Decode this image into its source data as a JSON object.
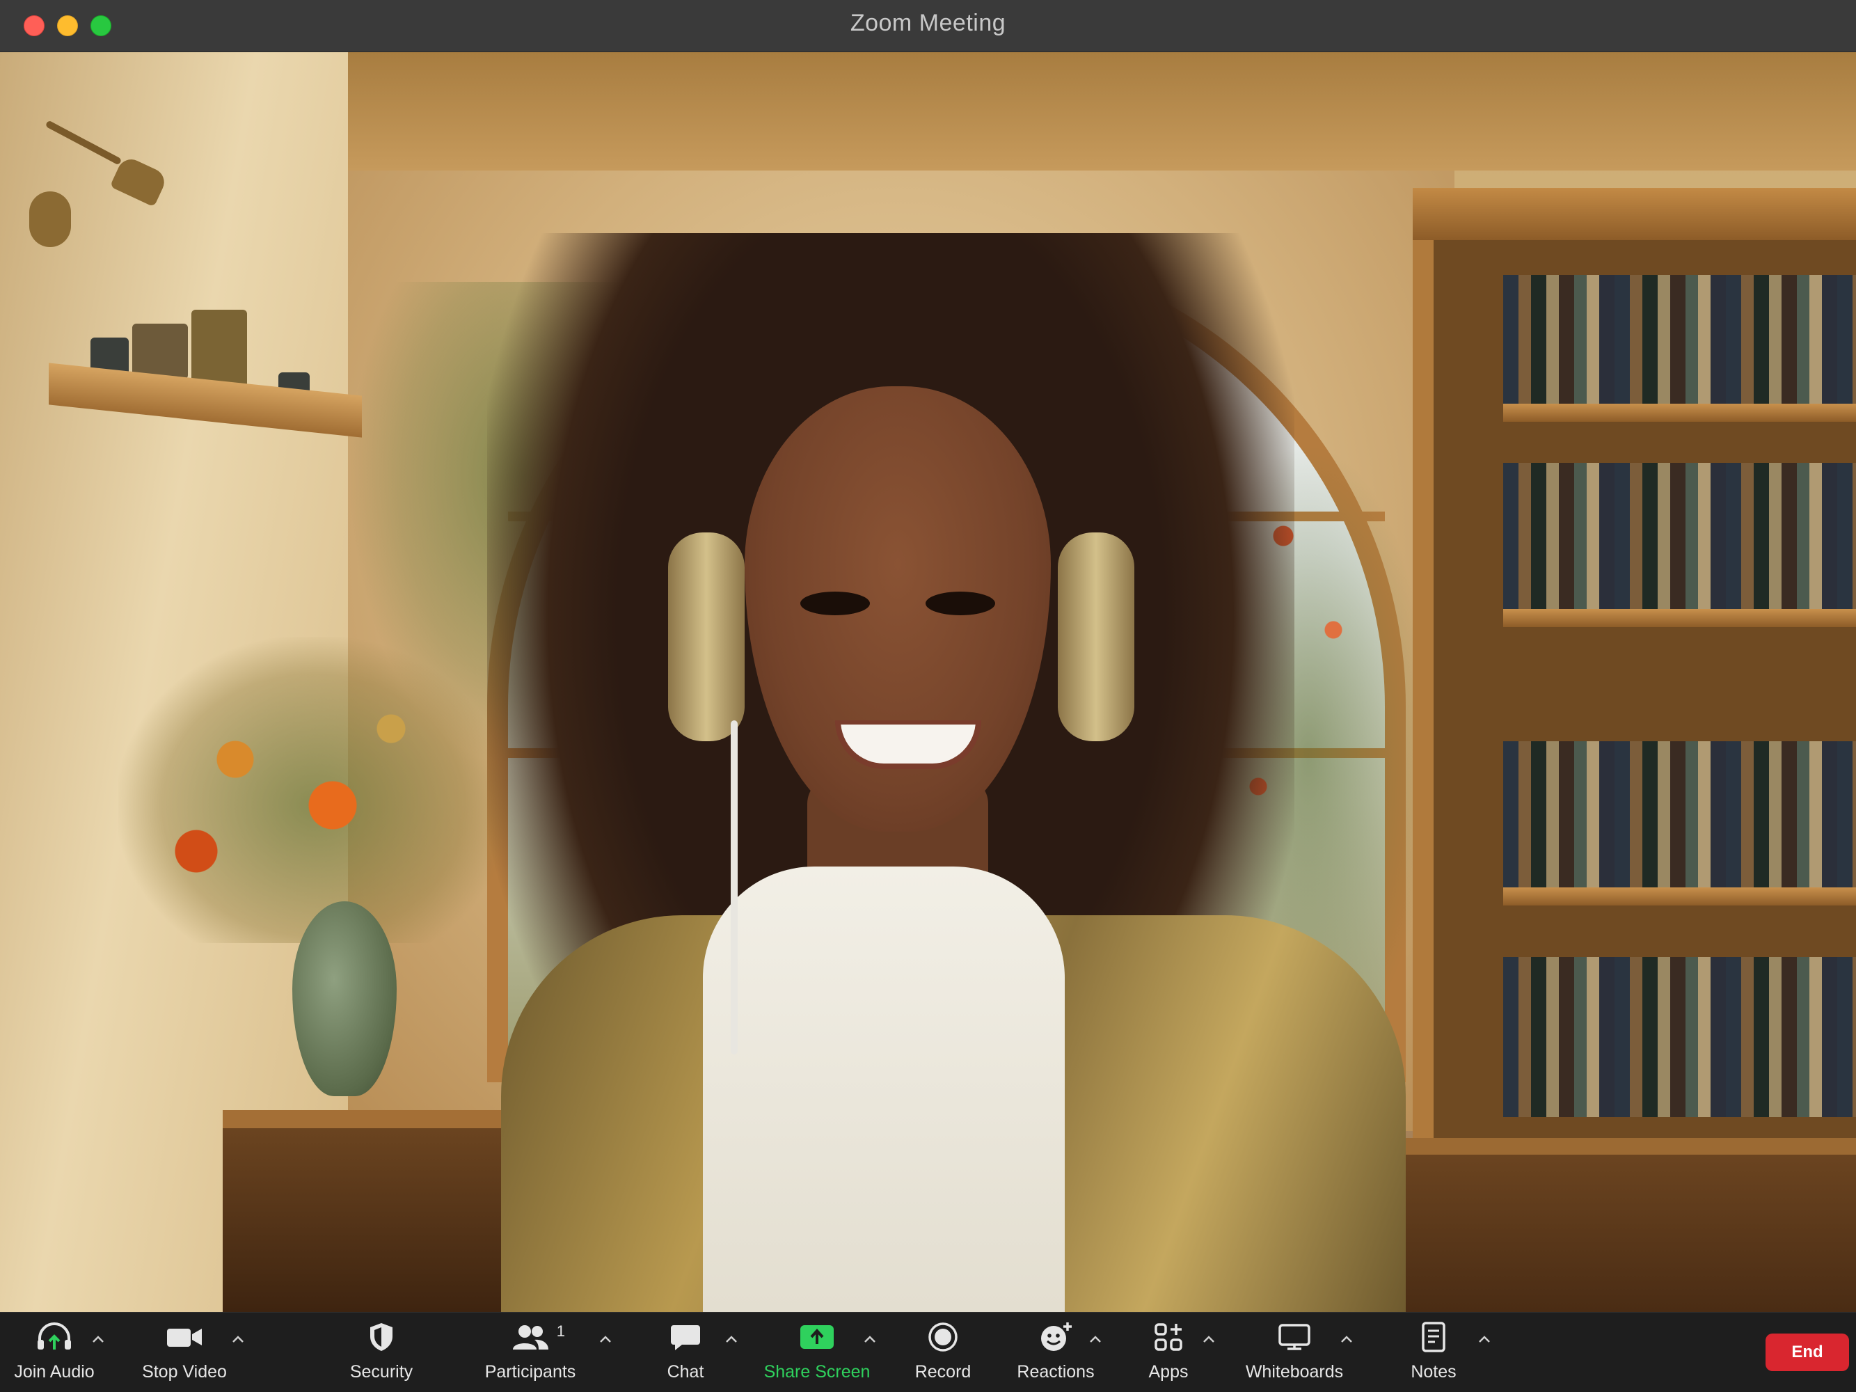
{
  "window": {
    "title": "Zoom Meeting"
  },
  "toolbar": {
    "join_audio": "Join Audio",
    "stop_video": "Stop Video",
    "security": "Security",
    "participants": "Participants",
    "participants_count": "1",
    "chat": "Chat",
    "share_screen": "Share Screen",
    "record": "Record",
    "reactions": "Reactions",
    "apps": "Apps",
    "whiteboards": "Whiteboards",
    "notes": "Notes",
    "end": "End"
  },
  "icons": {
    "join_audio": "headphones-icon",
    "stop_video": "video-camera-icon",
    "security": "shield-icon",
    "participants": "people-icon",
    "chat": "chat-bubble-icon",
    "share_screen": "share-up-arrow-icon",
    "record": "record-circle-icon",
    "reactions": "smiley-plus-icon",
    "apps": "apps-grid-icon",
    "whiteboards": "whiteboard-icon",
    "notes": "notes-icon"
  },
  "colors": {
    "share_screen_accent": "#2fd15d",
    "end_button": "#d9262f",
    "toolbar_bg": "#1e1e1e",
    "titlebar_bg": "#3a3a3a"
  }
}
